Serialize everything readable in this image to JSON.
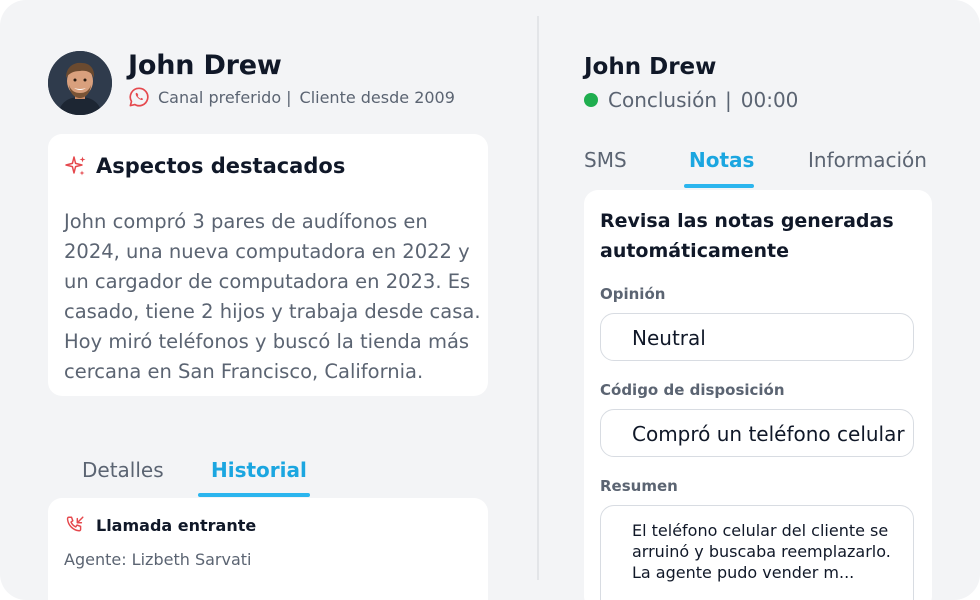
{
  "customer": {
    "name": "John Drew",
    "preferred_channel": "Canal preferido",
    "separator": "|",
    "since": "Cliente desde 2009"
  },
  "highlights": {
    "title": "Aspectos destacados",
    "body": "John compró 3 pares de audífonos en 2024, una nueva computadora en 2022 y un cargador de computadora en 2023. Es casado, tiene 2 hijos y trabaja desde casa. Hoy miró teléfonos y buscó la tienda más cercana en San Francisco, California."
  },
  "left_tabs": [
    {
      "label": "Detalles",
      "active": false
    },
    {
      "label": "Historial",
      "active": true
    }
  ],
  "history": {
    "title": "Llamada entrante",
    "agent": "Agente: Lizbeth Sarvati"
  },
  "call": {
    "name": "John Drew",
    "status": "Conclusión",
    "separator": "|",
    "timer": "00:00",
    "status_color": "#1fae4f"
  },
  "right_tabs": [
    {
      "label": "SMS",
      "active": false
    },
    {
      "label": "Notas",
      "active": true
    },
    {
      "label": "Información",
      "active": false
    }
  ],
  "notes": {
    "title": "Revisa las notas generadas automáticamente",
    "opinion_label": "Opinión",
    "opinion_value": "Neutral",
    "disposition_label": "Código de disposición",
    "disposition_value": "Compró un teléfono celular",
    "summary_label": "Resumen",
    "summary_value": "El teléfono celular del cliente se arruinó y buscaba reemplazarlo. La agente pudo vender m..."
  },
  "colors": {
    "accent": "#1ba6e0",
    "whatsapp_icon": "#e5484d",
    "sparkle_icon": "#e5484d"
  }
}
